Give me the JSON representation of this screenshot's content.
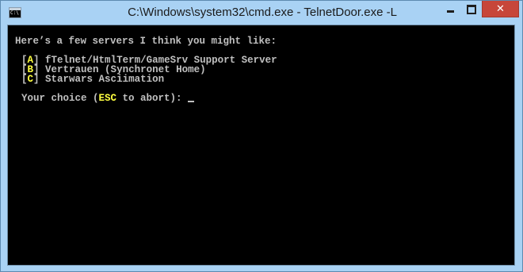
{
  "window": {
    "title": "C:\\Windows\\system32\\cmd.exe - TelnetDoor.exe  -L",
    "icon_label": "C:\\",
    "controls": {
      "minimize": "minimize-icon",
      "maximize": "maximize-icon",
      "close": "close-icon",
      "close_glyph": "✕"
    }
  },
  "console": {
    "heading": "Here’s a few servers I think you might like:",
    "options": [
      {
        "open": "[",
        "key": "A",
        "close": "]",
        "label": " fTelnet/HtmlTerm/GameSrv Support Server"
      },
      {
        "open": "[",
        "key": "B",
        "close": "]",
        "label": " Vertrauen (Synchronet Home)"
      },
      {
        "open": "[",
        "key": "C",
        "close": "]",
        "label": " Starwars Asciimation"
      }
    ],
    "prompt_before": "Your choice (",
    "prompt_key": "ESC",
    "prompt_after": " to abort): "
  },
  "colors": {
    "titlebar": "#a9d2f4",
    "console_bg": "#000000",
    "console_text": "#c0c0c0",
    "highlight": "#ffff40",
    "close_button": "#c7463a"
  }
}
